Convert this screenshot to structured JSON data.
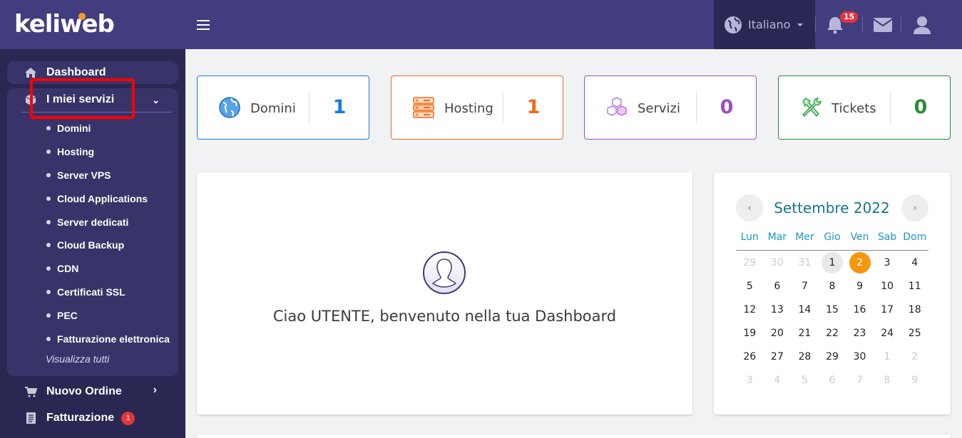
{
  "header": {
    "logo_text": "keliweb",
    "language": "Italiano",
    "notifications_count": "15",
    "colors": {
      "bar": "#413d7e",
      "accent_dot": "#f0a020"
    }
  },
  "sidebar": {
    "dashboard": "Dashboard",
    "services": {
      "label": "I miei servizi",
      "items": [
        {
          "label": "Domini"
        },
        {
          "label": "Hosting"
        },
        {
          "label": "Server VPS"
        },
        {
          "label": "Cloud Applications"
        },
        {
          "label": "Server dedicati"
        },
        {
          "label": "Cloud Backup"
        },
        {
          "label": "CDN"
        },
        {
          "label": "Certificati SSL"
        },
        {
          "label": "PEC"
        },
        {
          "label": "Fatturazione elettronica"
        }
      ],
      "see_all": "Visualizza tutti"
    },
    "new_order": "Nuovo Ordine",
    "billing": "Fatturazione",
    "billing_badge": "1"
  },
  "stats": [
    {
      "label": "Domini",
      "value": "1",
      "color": "#1a7ae0"
    },
    {
      "label": "Hosting",
      "value": "1",
      "color": "#f06a14"
    },
    {
      "label": "Servizi",
      "value": "0",
      "color": "#9a52c0"
    },
    {
      "label": "Tickets",
      "value": "0",
      "color": "#2e8a3a"
    }
  ],
  "welcome": {
    "message": "Ciao UTENTE, benvenuto nella tua Dashboard"
  },
  "calendar": {
    "title": "Settembre 2022",
    "prev": "‹",
    "next": "›",
    "weekdays": [
      "Lun",
      "Mar",
      "Mer",
      "Gio",
      "Ven",
      "Sab",
      "Dom"
    ],
    "weeks": [
      [
        {
          "d": "29",
          "m": 1
        },
        {
          "d": "30",
          "m": 1
        },
        {
          "d": "31",
          "m": 1
        },
        {
          "d": "1",
          "s": "mark"
        },
        {
          "d": "2",
          "s": "today"
        },
        {
          "d": "3"
        },
        {
          "d": "4"
        }
      ],
      [
        {
          "d": "5"
        },
        {
          "d": "6"
        },
        {
          "d": "7"
        },
        {
          "d": "8"
        },
        {
          "d": "9"
        },
        {
          "d": "10"
        },
        {
          "d": "11"
        }
      ],
      [
        {
          "d": "12"
        },
        {
          "d": "13"
        },
        {
          "d": "14"
        },
        {
          "d": "15"
        },
        {
          "d": "16"
        },
        {
          "d": "17"
        },
        {
          "d": "18"
        }
      ],
      [
        {
          "d": "19"
        },
        {
          "d": "20"
        },
        {
          "d": "21"
        },
        {
          "d": "22"
        },
        {
          "d": "23"
        },
        {
          "d": "24"
        },
        {
          "d": "25"
        }
      ],
      [
        {
          "d": "26"
        },
        {
          "d": "27"
        },
        {
          "d": "28"
        },
        {
          "d": "29"
        },
        {
          "d": "30"
        },
        {
          "d": "1",
          "m": 1
        },
        {
          "d": "2",
          "m": 1
        }
      ],
      [
        {
          "d": "3",
          "m": 1
        },
        {
          "d": "4",
          "m": 1
        },
        {
          "d": "5",
          "m": 1
        },
        {
          "d": "6",
          "m": 1
        },
        {
          "d": "7",
          "m": 1
        },
        {
          "d": "8",
          "m": 1
        },
        {
          "d": "9",
          "m": 1
        }
      ]
    ]
  }
}
